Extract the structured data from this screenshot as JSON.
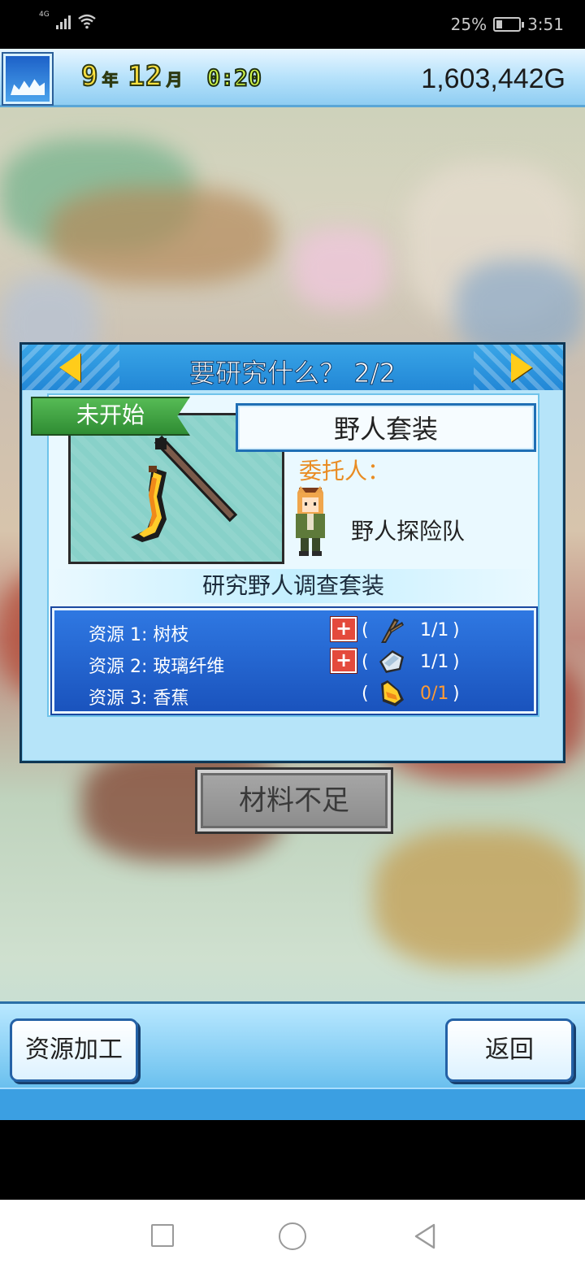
{
  "status_bar": {
    "network": "4G",
    "battery": "25%",
    "battery_level": 0.25,
    "time": "3:51"
  },
  "hud": {
    "year": "9",
    "year_unit": "年",
    "month": "12",
    "month_unit": "月",
    "clock": "0:20",
    "money": "1,603,442G",
    "season_icon": "winter-snow-icon"
  },
  "dialog": {
    "title": "要研究什么？ 2/2",
    "status_tag": "未开始",
    "item_name": "野人套装",
    "client_label": "委托人：",
    "client_name": "野人探险队",
    "description": "研究野人调查套装",
    "resources": [
      {
        "label": "资源 1: 树枝",
        "icon": "branch-icon",
        "count": "1/1",
        "has_plus": true,
        "sufficient": true
      },
      {
        "label": "资源 2: 玻璃纤维",
        "icon": "glass-fiber-icon",
        "count": "1/1",
        "has_plus": true,
        "sufficient": true
      },
      {
        "label": "资源 3: 香蕉",
        "icon": "banana-icon",
        "count": "0/1",
        "has_plus": false,
        "sufficient": false
      }
    ],
    "paren_open": "(",
    "paren_close": ")",
    "plus": "+"
  },
  "materials_button": "材料不足",
  "bottom": {
    "process_button": "资源加工",
    "back_button": "返回"
  },
  "colors": {
    "accent_blue": "#2287d6",
    "status_green": "#2f8c33",
    "insufficient_orange": "#ff9b34",
    "client_orange": "#e98c23"
  }
}
